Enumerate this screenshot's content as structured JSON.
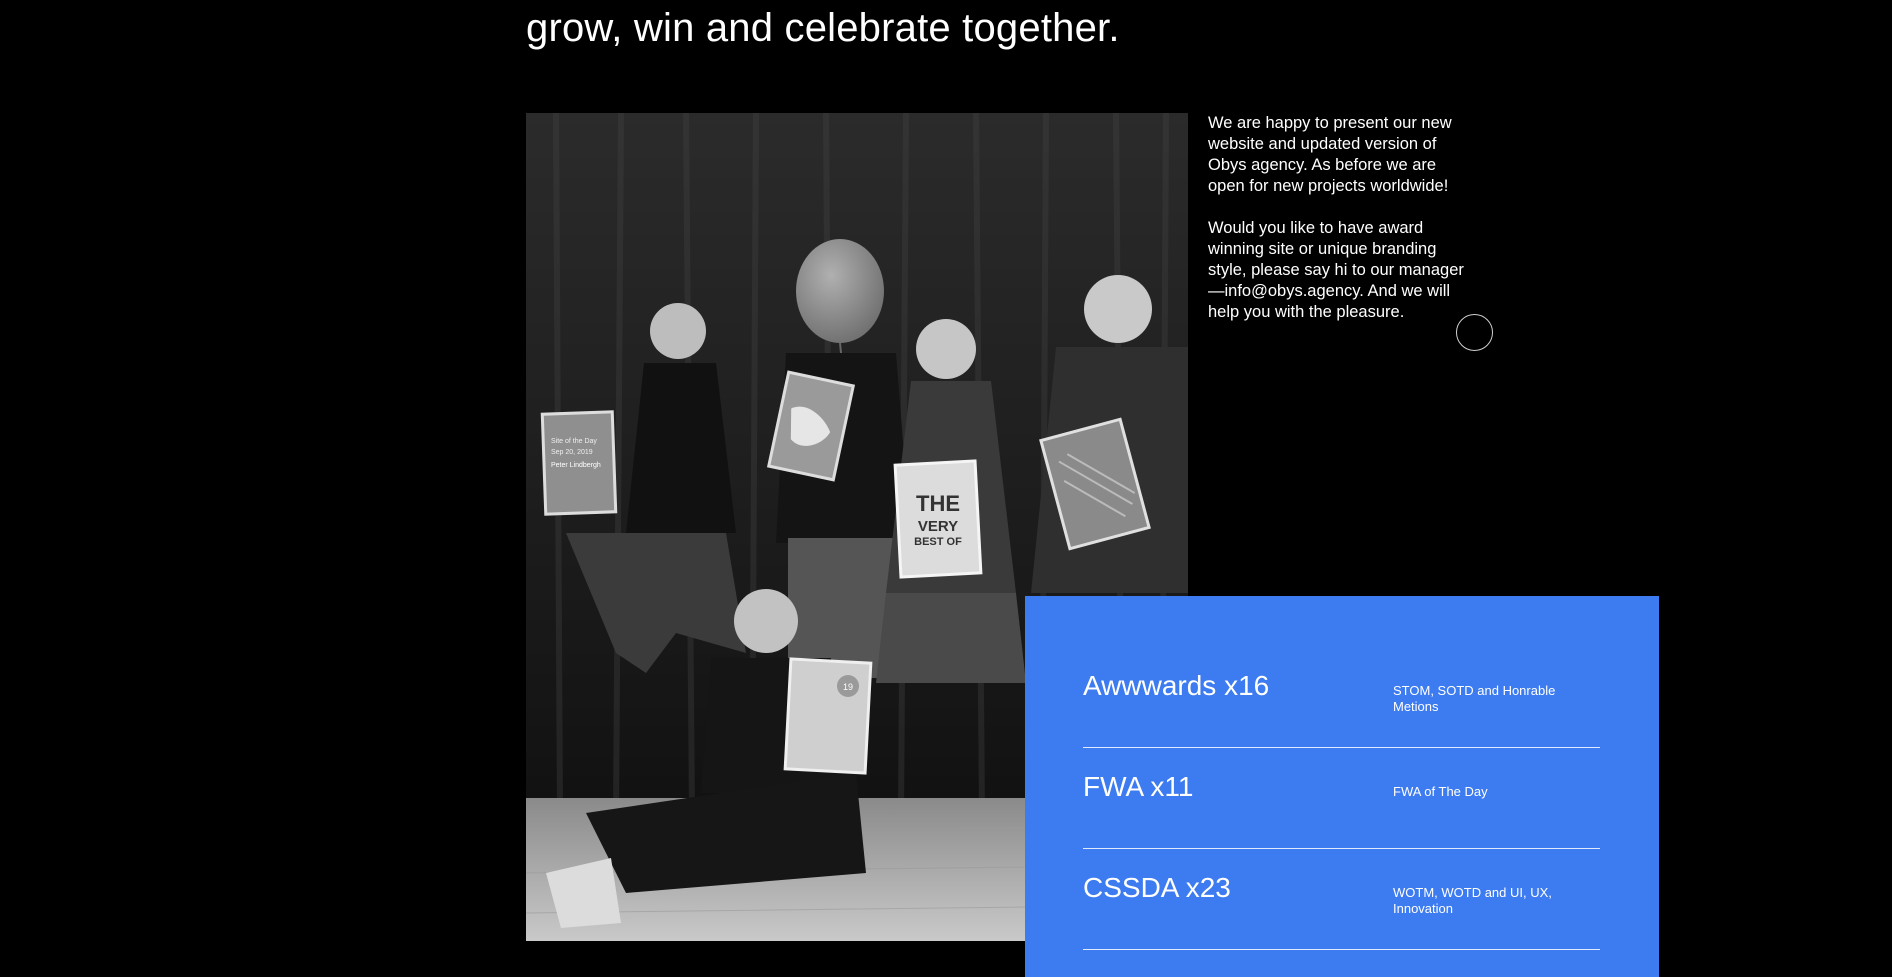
{
  "hero": {
    "heading": "grow, win and celebrate together."
  },
  "photo": {
    "alt": "Obys team holding award certificates",
    "certificates": {
      "c1_line1": "Site of the Day",
      "c1_line2": "Sep 20, 2019",
      "c1_line3": "Peter Lindbergh",
      "c3_line1": "THE",
      "c3_line2": "VERY",
      "c3_line3": "BEST OF",
      "c5_badge": "19"
    }
  },
  "intro": {
    "paragraph1": "We are happy to present our new website and updated version of Obys agency. As before we are open for new projects worldwide!",
    "paragraph2": "Would you like to have award winning site or unique branding style, please say hi to our manager —info@obys.agency. And we will help you with the pleasure."
  },
  "awards": [
    {
      "name": "Awwwards x16",
      "detail": "STOM, SOTD and Honrable Metions"
    },
    {
      "name": "FWA x11",
      "detail": "FWA of The Day"
    },
    {
      "name": "CSSDA x23",
      "detail": "WOTM, WOTD and UI, UX, Innovation"
    }
  ],
  "colors": {
    "background": "#000000",
    "accent_panel": "#3d7bf0",
    "text": "#ffffff"
  }
}
